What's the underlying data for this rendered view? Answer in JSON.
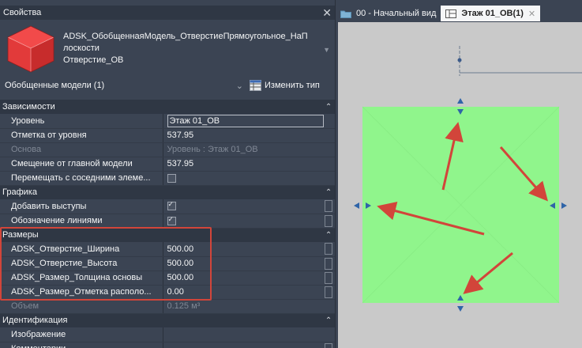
{
  "panel": {
    "title": "Свойства",
    "family_name_line1": "ADSK_ОбобщеннаяМодель_ОтверстиеПрямоугольное_НаП",
    "family_name_line2": "лоскости",
    "type_name": "Отверстие_ОВ",
    "selection_label": "Обобщенные модели (1)",
    "edit_type_label": "Изменить тип"
  },
  "categories": {
    "dependencies": "Зависимости",
    "graphics": "Графика",
    "dimensions": "Размеры",
    "identification": "Идентификация"
  },
  "dependencies": [
    {
      "name": "Уровень",
      "value": "Этаж 01_ОВ"
    },
    {
      "name": "Отметка от уровня",
      "value": "537.95"
    },
    {
      "name": "Основа",
      "value": "Уровень : Этаж 01_ОВ"
    },
    {
      "name": "Смещение от главной модели",
      "value": "537.95"
    },
    {
      "name": "Перемещать с соседними элеме...",
      "value": ""
    }
  ],
  "graphics": [
    {
      "name": "Добавить выступы",
      "checked": true
    },
    {
      "name": "Обозначение линиями",
      "checked": true
    }
  ],
  "dimensions": [
    {
      "name": "ADSK_Отверстие_Ширина",
      "value": "500.00"
    },
    {
      "name": "ADSK_Отверстие_Высота",
      "value": "500.00"
    },
    {
      "name": "ADSK_Размер_Толщина основы",
      "value": "500.00"
    },
    {
      "name": "ADSK_Размер_Отметка располо...",
      "value": "0.00"
    },
    {
      "name": "Объем",
      "value": "0.125 м³"
    }
  ],
  "identification": [
    {
      "name": "Изображение",
      "value": ""
    },
    {
      "name": "Комментарии",
      "value": ""
    }
  ],
  "tabs": [
    {
      "label": "00 - Начальный вид"
    },
    {
      "label": "Этаж 01_ОВ(1)"
    }
  ],
  "colors": {
    "panel_bg": "#3b4453",
    "category_bg": "#2f3744",
    "opening_fill": "#90f58c",
    "annotation_red": "#d2453a",
    "grip_blue": "#1f4f8a"
  }
}
